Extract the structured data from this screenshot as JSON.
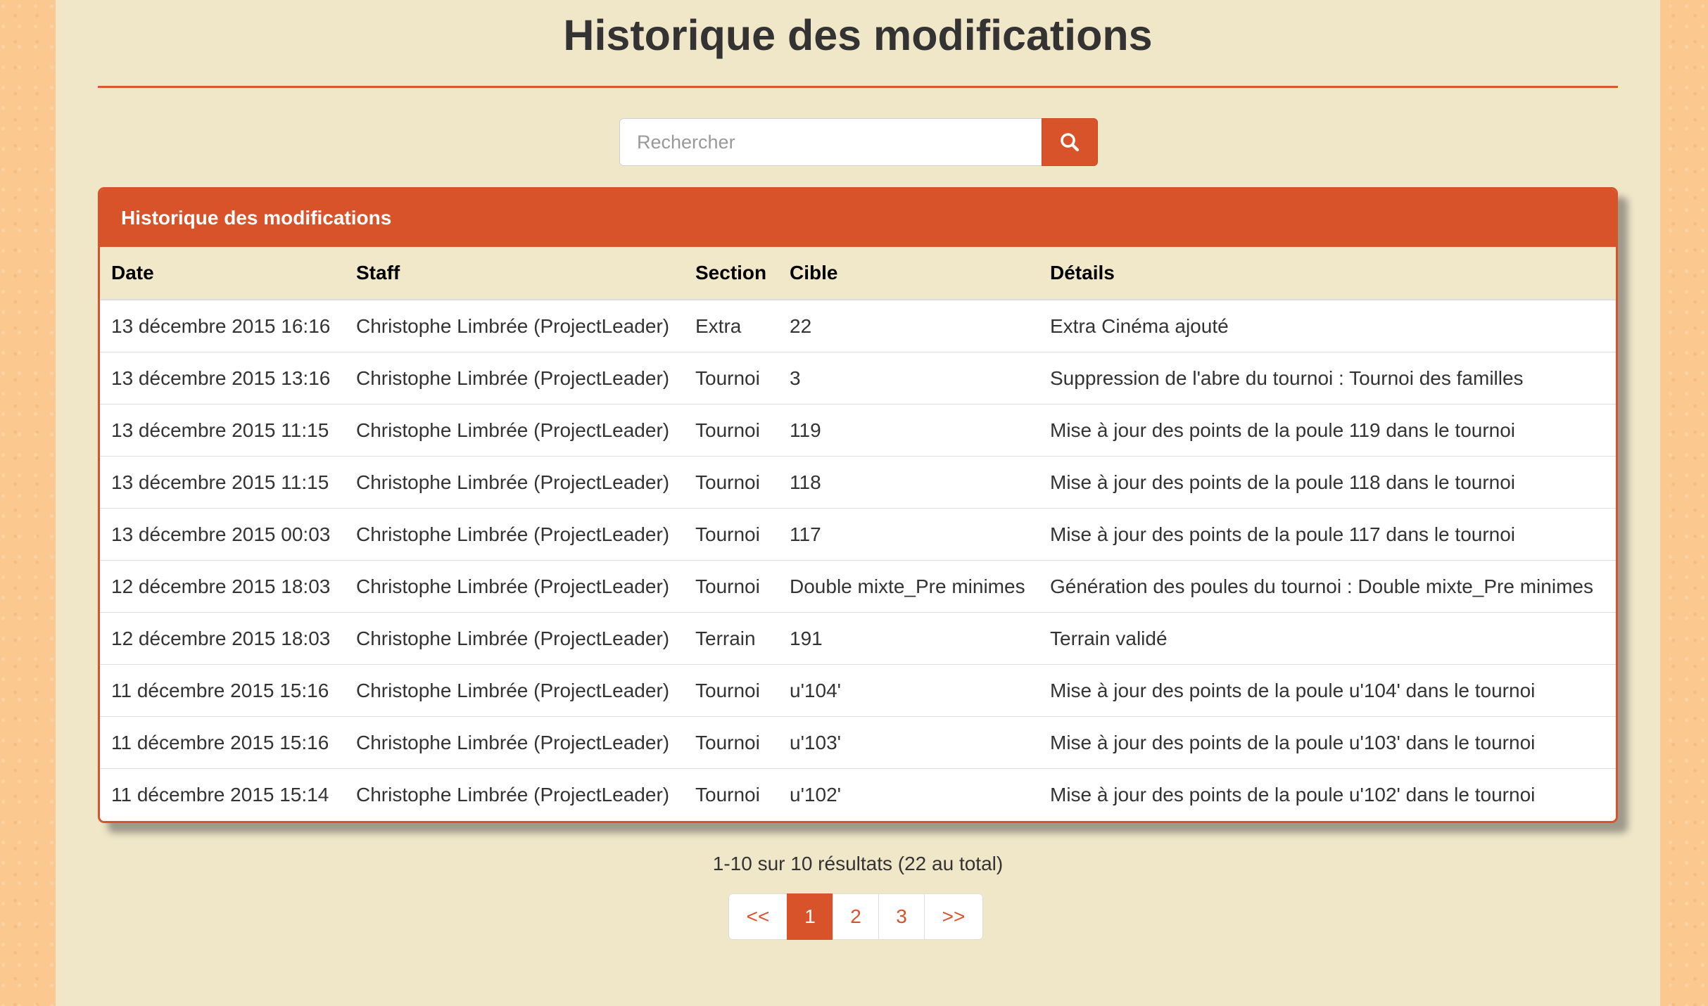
{
  "header": {
    "title": "Historique des modifications"
  },
  "search": {
    "placeholder": "Rechercher",
    "button_icon": "search-icon"
  },
  "panel": {
    "title": "Historique des modifications"
  },
  "table": {
    "columns": [
      "Date",
      "Staff",
      "Section",
      "Cible",
      "Détails"
    ],
    "rows": [
      [
        "13 décembre 2015 16:16",
        "Christophe Limbrée (ProjectLeader)",
        "Extra",
        "22",
        "Extra Cinéma ajouté"
      ],
      [
        "13 décembre 2015 13:16",
        "Christophe Limbrée (ProjectLeader)",
        "Tournoi",
        "3",
        "Suppression de l'abre du tournoi : Tournoi des familles"
      ],
      [
        "13 décembre 2015 11:15",
        "Christophe Limbrée (ProjectLeader)",
        "Tournoi",
        "119",
        "Mise à jour des points de la poule 119 dans le tournoi"
      ],
      [
        "13 décembre 2015 11:15",
        "Christophe Limbrée (ProjectLeader)",
        "Tournoi",
        "118",
        "Mise à jour des points de la poule 118 dans le tournoi"
      ],
      [
        "13 décembre 2015 00:03",
        "Christophe Limbrée (ProjectLeader)",
        "Tournoi",
        "117",
        "Mise à jour des points de la poule 117 dans le tournoi"
      ],
      [
        "12 décembre 2015 18:03",
        "Christophe Limbrée (ProjectLeader)",
        "Tournoi",
        "Double mixte_Pre minimes",
        "Génération des poules du tournoi : Double mixte_Pre minimes"
      ],
      [
        "12 décembre 2015 18:03",
        "Christophe Limbrée (ProjectLeader)",
        "Terrain",
        "191",
        "Terrain validé"
      ],
      [
        "11 décembre 2015 15:16",
        "Christophe Limbrée (ProjectLeader)",
        "Tournoi",
        "u'104'",
        "Mise à jour des points de la poule u'104' dans le tournoi"
      ],
      [
        "11 décembre 2015 15:16",
        "Christophe Limbrée (ProjectLeader)",
        "Tournoi",
        "u'103'",
        "Mise à jour des points de la poule u'103' dans le tournoi"
      ],
      [
        "11 décembre 2015 15:14",
        "Christophe Limbrée (ProjectLeader)",
        "Tournoi",
        "u'102'",
        "Mise à jour des points de la poule u'102' dans le tournoi"
      ]
    ]
  },
  "results": {
    "summary": "1-10 sur 10 résultats (22 au total)"
  },
  "pagination": {
    "first": "<<",
    "pages": [
      "1",
      "2",
      "3"
    ],
    "active_page": "1",
    "last": ">>"
  },
  "colors": {
    "accent": "#d9532a",
    "page_background": "#f0e6c8",
    "body_background": "#fbc990",
    "header_row_background": "#f0e8c8"
  }
}
